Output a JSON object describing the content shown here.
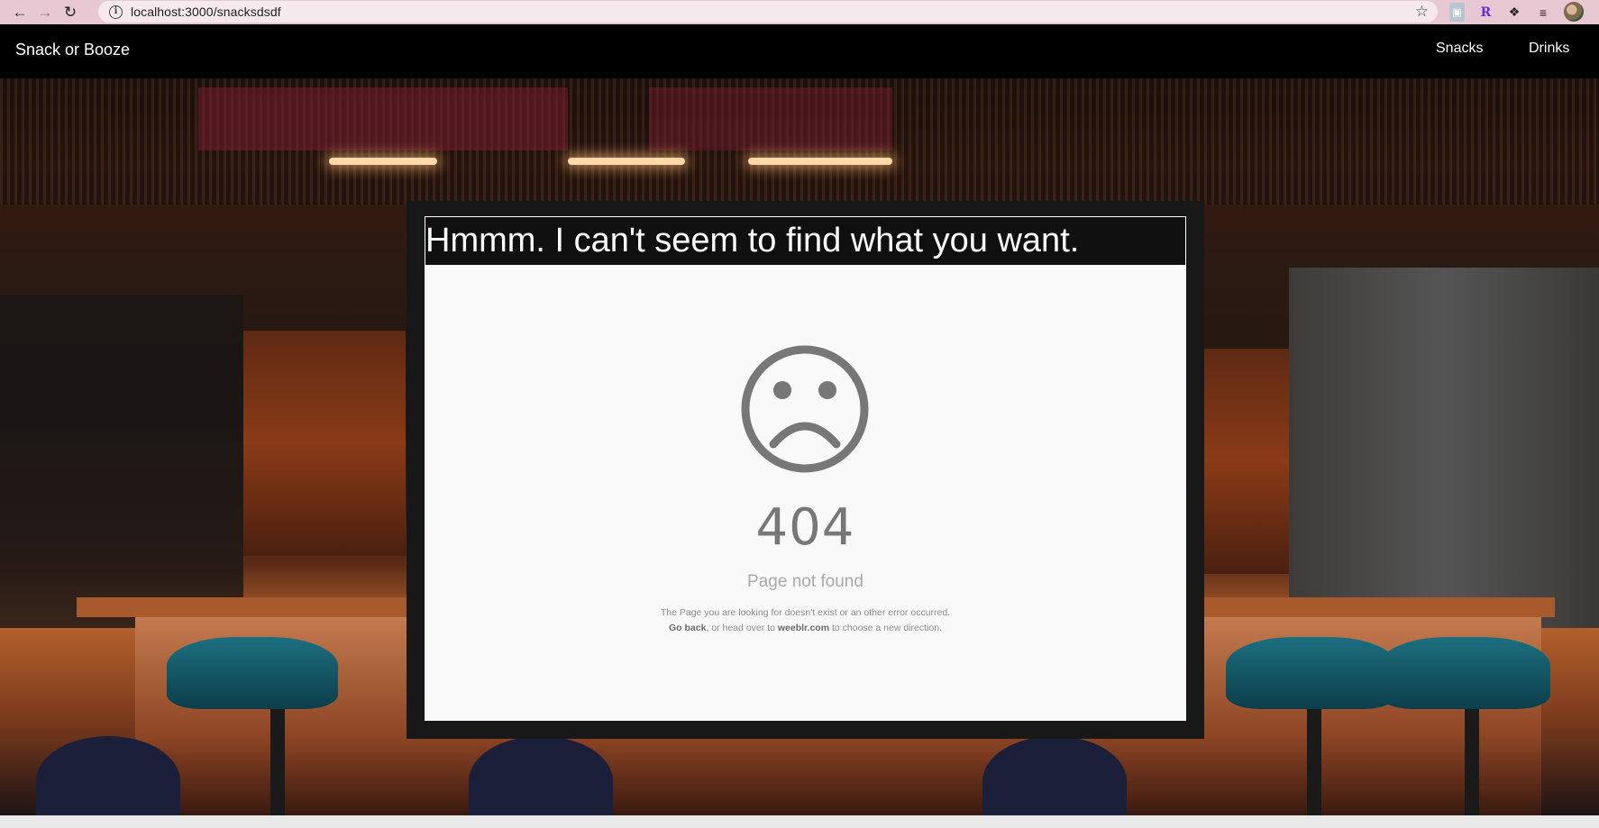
{
  "browser": {
    "url": "localhost:3000/snacksdsdf",
    "extensions": [
      "image-extension-icon",
      "R",
      "puzzle-icon",
      "reading-list-icon"
    ]
  },
  "navbar": {
    "brand": "Snack or Booze",
    "links": [
      "Snacks",
      "Drinks"
    ]
  },
  "card": {
    "title": "Hmmm. I can't seem to find what you want.",
    "image": {
      "code": "404",
      "heading": "Page not found",
      "line1": "The Page you are looking for doesn't exist or an other error occurred.",
      "line2_link1": "Go back",
      "line2_mid": ", or head over to ",
      "line2_link2": "weeblr.com",
      "line2_end": " to choose a new direction."
    }
  },
  "colors": {
    "navbar_bg": "#000000",
    "card_bg": "#181818",
    "chrome_bg": "#e8c8d2"
  }
}
